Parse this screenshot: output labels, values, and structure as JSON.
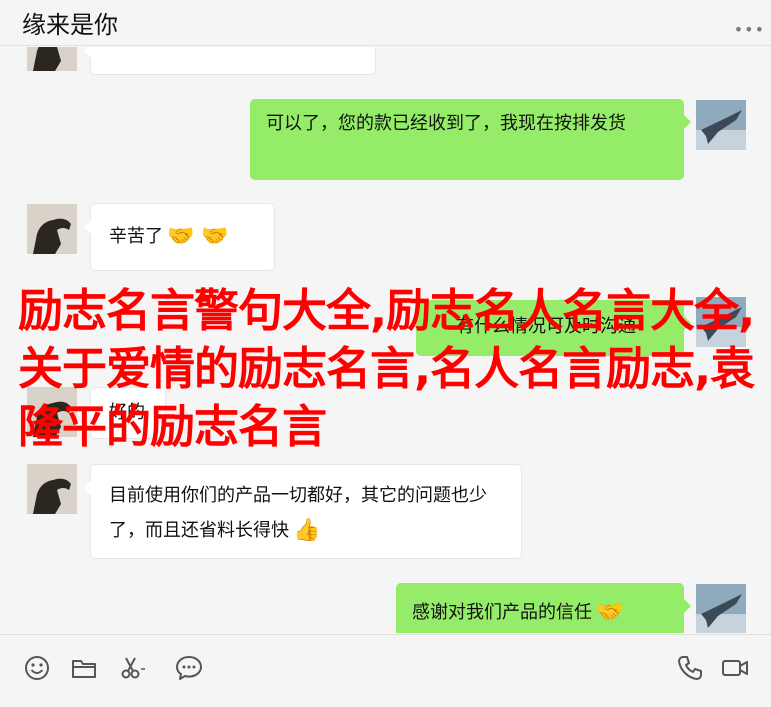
{
  "header": {
    "title": "缘来是你",
    "more_label": "•••"
  },
  "messages": [
    {
      "side": "in",
      "text": "",
      "emoji": ""
    },
    {
      "side": "out",
      "text": "可以了，您的款已经收到了，我现在按排发货",
      "emoji": ""
    },
    {
      "side": "in",
      "text": "辛苦了",
      "emoji": "🤝 🤝"
    },
    {
      "side": "out",
      "text": "有什么情况可及时沟通",
      "emoji": ""
    },
    {
      "side": "in",
      "text": "好的",
      "emoji": ""
    },
    {
      "side": "in",
      "text": "目前使用你们的产品一切都好，其它的问题也少了，而且还省料长得快",
      "emoji": "👍"
    },
    {
      "side": "out",
      "text": "感谢对我们产品的信任",
      "emoji": "🤝"
    }
  ],
  "overlay": {
    "text": "励志名言警句大全,励志名人名言大全,关于爱情的励志名言,名人名言励志,袁隆平的励志名言",
    "color": "#ff0000"
  },
  "colors": {
    "outgoing_bubble": "#95ec69",
    "incoming_bubble": "#ffffff",
    "background": "#f5f5f5"
  },
  "toolbar": {
    "left_icons": [
      "emoji-icon",
      "folder-icon",
      "scissors-icon",
      "chat-bubble-icon"
    ],
    "right_icons": [
      "phone-icon",
      "video-icon"
    ]
  }
}
